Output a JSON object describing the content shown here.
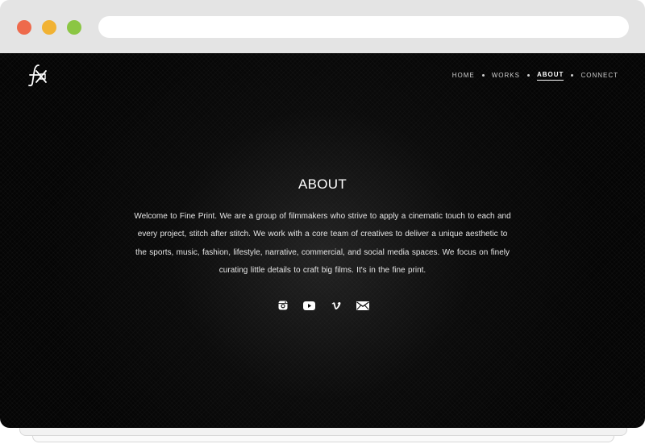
{
  "colors": {
    "close": "#ee6a4c",
    "minimize": "#f1b233",
    "maximize": "#8bc644",
    "page_background": "#050505",
    "text": "#ffffff"
  },
  "header": {
    "logo_icon": "fine-print-logo-icon"
  },
  "nav": {
    "items": [
      {
        "label": "HOME",
        "active": false
      },
      {
        "label": "WORKS",
        "active": false
      },
      {
        "label": "ABOUT",
        "active": true
      },
      {
        "label": "CONNECT",
        "active": false
      }
    ]
  },
  "main": {
    "title": "ABOUT",
    "paragraph": "Welcome to Fine Print. We are a group of filmmakers who strive to apply a cinematic touch to each and every project, stitch after stitch.  We work with a core team of creatives to deliver a unique aesthetic to the sports, music, fashion, lifestyle, narrative, commercial, and social media spaces.  We focus on finely curating little details to craft big films. It's in the fine print."
  },
  "social": {
    "icons": [
      "instagram-icon",
      "youtube-icon",
      "vimeo-icon",
      "email-icon"
    ]
  }
}
